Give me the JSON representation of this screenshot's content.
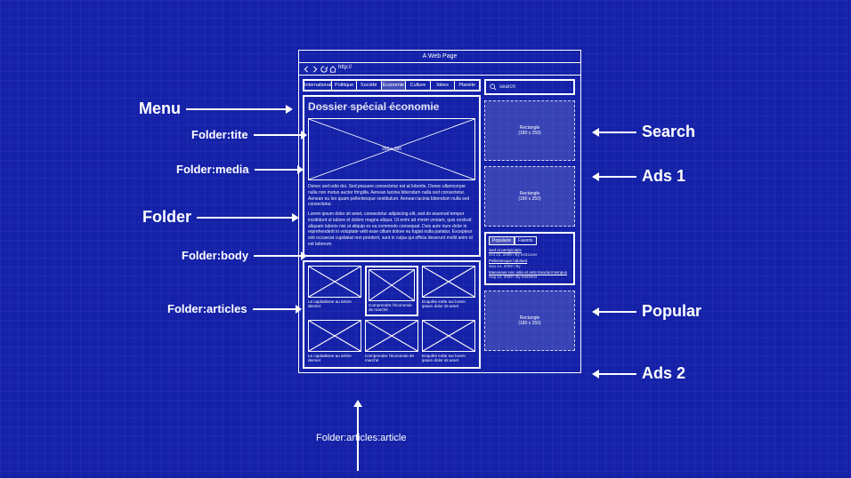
{
  "browser": {
    "title": "A Web Page",
    "url": "http://"
  },
  "menu": {
    "items": [
      "International",
      "Politique",
      "Société",
      "Économie",
      "Culture",
      "Idées",
      "Planète"
    ],
    "active_index": 3
  },
  "folder": {
    "title": "Dossier spécial économie",
    "media_label": "280 x 180",
    "body_p1": "Donec sed odio dui. Sed posuere consectetur est at lobortis. Donec ullamcorper nulla non metus auctor fringilla. Aenean lacinia bibendum nulla sed consectetur. Aenean eu leo quam pellentesque vestibulum. Aenean lacinia bibendum nulla sed consectetur.",
    "body_p2": "Lorem ipsum dolor sit amet, consectetur adipiscing elit, sed do eiusmod tempor incididunt ut labore et dolore magna aliqua. Ut enim ad minim veniam, quis nostrud aliquam laboris nisi ut aliquip ex ea commodo consequat. Duis aute irure dolor in reprehenderit in voluptate velit esse cillum dolore eu fugiat nulla pariatur. Excepteur sint occaecat cupidatat non proident, sunt in culpa qui officia deserunt mollit anim id est laborum."
  },
  "articles": [
    {
      "title": "Le capitalisme au siècle dernier"
    },
    {
      "title": "Comprendre l'économie de marché"
    },
    {
      "title": "Enquête inéte sur lorem ipsum dolor sit amet"
    },
    {
      "title": "Le capitalisme au siècle dernier"
    },
    {
      "title": "Comprendre l'économie de marché"
    },
    {
      "title": "Enquête inéte sur lorem ipsum dolor sit amet"
    }
  ],
  "search": {
    "placeholder": "search"
  },
  "ads": {
    "ad1_label": "Rectangle",
    "ad1_dim": "(180 x 250)",
    "ad2_label": "Rectangle",
    "ad2_dim": "(180 x 250)",
    "ad3_label": "Rectangle",
    "ad3_dim": "(180 x 250)"
  },
  "popular": {
    "tabs": [
      "Populaire",
      "Favoris"
    ],
    "active_tab": 0,
    "items": [
      {
        "title": "Sed ut perspiciatis",
        "meta": "Oct 23, 2009 / By test1user"
      },
      {
        "title": "Pellentesque habitant",
        "meta": "Sep 14, 2009 / By"
      },
      {
        "title": "Maecenas nec odio et ante tincidunt tempus",
        "meta": "Aug 12, 2009 / By test2test"
      }
    ]
  },
  "annotations": {
    "menu": "Menu",
    "folder_title": "Folder:tite",
    "folder_media": "Folder:media",
    "folder": "Folder",
    "folder_body": "Folder:body",
    "folder_articles": "Folder:articles",
    "folder_article": "Folder:articles:article",
    "search": "Search",
    "ads1": "Ads 1",
    "popular": "Popular",
    "ads2": "Ads 2"
  }
}
